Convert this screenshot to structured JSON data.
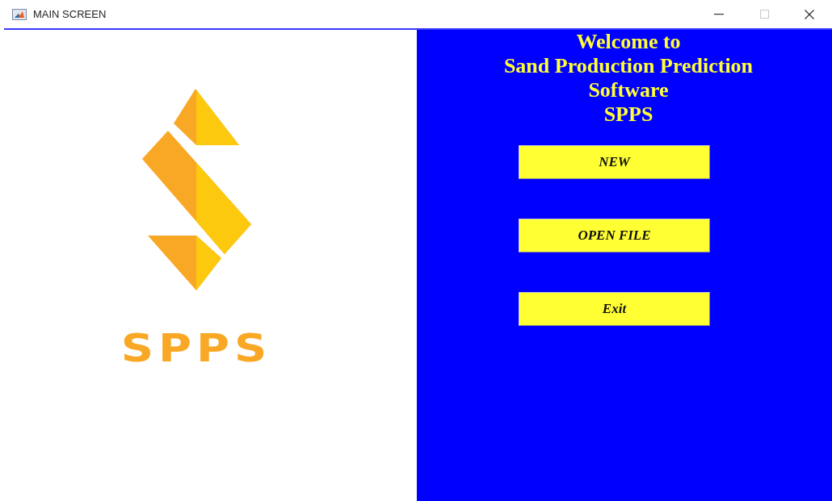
{
  "window": {
    "title": "MAIN SCREEN",
    "maximize_disabled": true
  },
  "logo": {
    "text": "SPPS"
  },
  "welcome": [
    "Welcome to",
    "Sand Production Prediction",
    "Software",
    "SPPS"
  ],
  "buttons": [
    "NEW",
    "OPEN FILE",
    "Exit"
  ]
}
